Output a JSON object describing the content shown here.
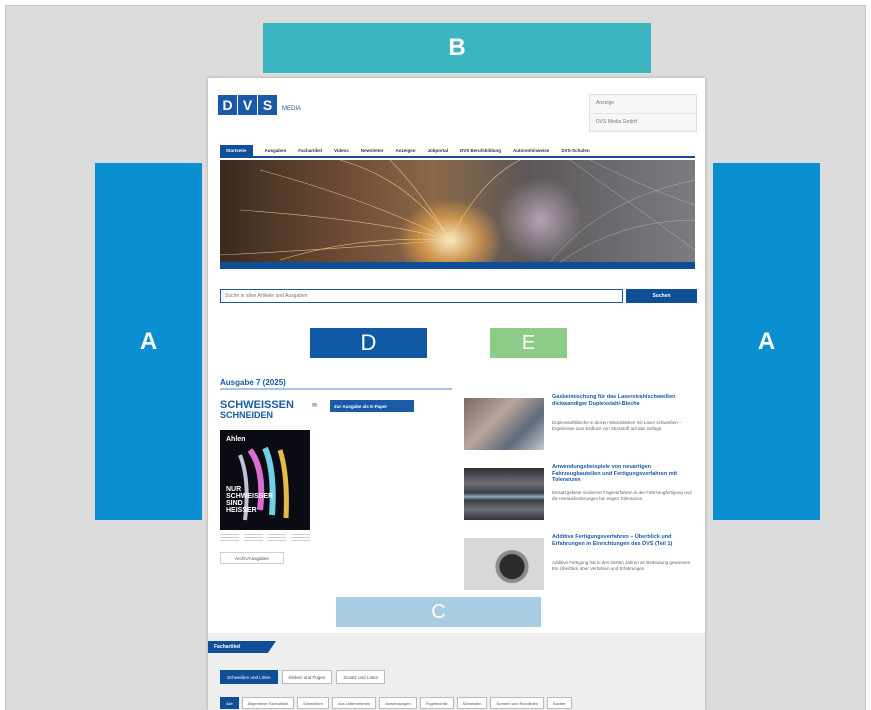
{
  "labels": {
    "a_left": "A",
    "a_right": "A",
    "b": "B",
    "c": "C",
    "d": "D",
    "e": "E"
  },
  "colors": {
    "label_a": "#0a8fd1",
    "label_b": "#3bb5c0",
    "label_c": "#a8cde3",
    "label_d": "#0f59a5",
    "label_e": "#8ccb88",
    "brand_blue": "#0f4f97",
    "background": "#dcdcdc"
  },
  "header": {
    "logo_letters": [
      "D",
      "V",
      "S"
    ],
    "logo_sub": "MEDIA",
    "box_lines": [
      "Anzeige",
      "DVS Media GmbH"
    ]
  },
  "nav": {
    "items": [
      "Startseite",
      "Ausgaben",
      "Fachartikel",
      "Videos",
      "Newsletter",
      "Anzeigen",
      "Jobportal",
      "DVS Berufsbildung",
      "Autorenhinweise",
      "DVS-Schulen"
    ]
  },
  "search": {
    "placeholder": "Suche in allen Artikeln und Ausgaben",
    "button": "Suchen"
  },
  "issue": {
    "title": "Ausgabe 7 (2025)",
    "mag_line1": "SCHWEISSEN",
    "mag_line2": "SCHNEIDEN",
    "cover_brand": "Ahlen",
    "cover_text": "NUR SCHWEISSER SIND HEISSER",
    "epaper_button": "Zur Ausgabe als E-Paper",
    "archive_button": "Archiv/Ausgaben"
  },
  "articles": [
    {
      "title": "Gasbeimischung für das Laserstrahlschweißen dickwandiger Duplexstahl-Bleche",
      "text": "Duplexstahlbleche in dicken Wandstärken mit Laser schweißen – Ergebnisse zum Einfluss von Stickstoff auf das Gefüge."
    },
    {
      "title": "Anwendungsbeispiele von neuartigen Fahrzeugbauteilen und Fertigungsverfahren mit Toleranzen",
      "text": "Einsatzgebiete moderner Fügeverfahren in der Fahrzeugfertigung und die Herausforderungen bei engen Toleranzen."
    },
    {
      "title": "Additive Fertigungsverfahren – Überblick und Erfahrungen in Einrichtungen des DVS (Teil 1)",
      "text": "Additive Fertigung hat in den letzten Jahren an Bedeutung gewonnen. Ein Überblick über Verfahren und Erfahrungen."
    }
  ],
  "bottom": {
    "section_title": "Fachartikel",
    "tabs": [
      "Schweißen und Löten",
      "Kleben und Fügen",
      "Zusatz und Löten"
    ],
    "chips": [
      "Alle",
      "Allgemeine Fachartikel",
      "Schweißen",
      "Aus Unternehmen",
      "Anwendungen",
      "Fügetechnik",
      "Schneiden",
      "Normen und Richtlinien",
      "Bücher"
    ]
  }
}
